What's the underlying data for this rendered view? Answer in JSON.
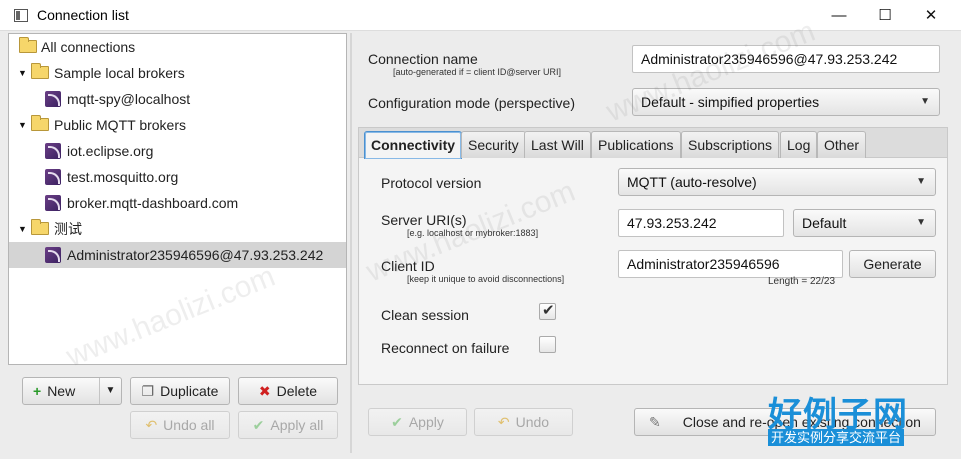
{
  "window": {
    "title": "Connection list",
    "min_glyph": "—",
    "max_glyph": "☐",
    "close_glyph": "✕"
  },
  "tree": {
    "root": "All connections",
    "groups": [
      {
        "label": "Sample local brokers",
        "items": [
          "mqtt-spy@localhost"
        ]
      },
      {
        "label": "Public MQTT brokers",
        "items": [
          "iot.eclipse.org",
          "test.mosquitto.org",
          "broker.mqtt-dashboard.com"
        ]
      },
      {
        "label": "测试",
        "items": [
          "Administrator235946596@47.93.253.242"
        ]
      }
    ],
    "selected": "Administrator235946596@47.93.253.242"
  },
  "left_buttons": {
    "new": "New",
    "duplicate": "Duplicate",
    "delete": "Delete",
    "undo_all": "Undo all",
    "apply_all": "Apply all"
  },
  "form": {
    "connection_name_label": "Connection name",
    "connection_name_hint": "[auto-generated if = client ID@server URI]",
    "connection_name_value": "Administrator235946596@47.93.253.242",
    "config_mode_label": "Configuration mode (perspective)",
    "config_mode_value": "Default - simpified properties"
  },
  "tabs": [
    "Connectivity",
    "Security",
    "Last Will",
    "Publications",
    "Subscriptions",
    "Log",
    "Other"
  ],
  "active_tab": "Connectivity",
  "connectivity": {
    "protocol_label": "Protocol version",
    "protocol_value": "MQTT (auto-resolve)",
    "server_label": "Server URI(s)",
    "server_hint": "[e.g. localhost or mybroker:1883]",
    "server_value": "47.93.253.242",
    "server_mode": "Default",
    "client_id_label": "Client ID",
    "client_id_hint": "[keep it unique to avoid disconnections]",
    "client_id_value": "Administrator235946596",
    "generate_label": "Generate",
    "length_text": "Length = 22/23",
    "clean_session_label": "Clean session",
    "clean_session_checked": true,
    "reconnect_label": "Reconnect on failure",
    "reconnect_checked": false
  },
  "bottom_buttons": {
    "apply": "Apply",
    "undo": "Undo",
    "close_reopen": "Close and re-open existing connection"
  },
  "watermark": {
    "text": "www.haolizi.com",
    "cn": "好例子网",
    "cn_sub": "开发实例分享交流平台"
  }
}
